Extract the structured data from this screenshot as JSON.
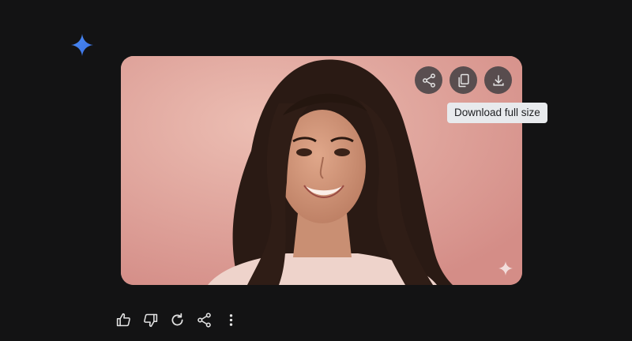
{
  "colors": {
    "background": "#131314",
    "accent_spark": "#4285f4",
    "icon": "#e3e3e3",
    "tooltip_bg": "#e8eaed",
    "tooltip_text": "#202124"
  },
  "assistant": {
    "logo_icon": "gemini-spark-icon"
  },
  "generated_image": {
    "alt": "Generated portrait",
    "actions": [
      {
        "name": "share",
        "icon": "share-icon"
      },
      {
        "name": "copy",
        "icon": "copy-icon"
      },
      {
        "name": "download",
        "icon": "download-icon"
      }
    ],
    "watermark_icon": "sparkle-watermark-icon"
  },
  "tooltip": {
    "text": "Download full size"
  },
  "feedback": [
    {
      "name": "good-response",
      "icon": "thumbs-up-icon"
    },
    {
      "name": "bad-response",
      "icon": "thumbs-down-icon"
    },
    {
      "name": "regenerate",
      "icon": "redo-icon"
    },
    {
      "name": "share",
      "icon": "share-icon"
    },
    {
      "name": "more",
      "icon": "more-vert-icon"
    }
  ]
}
